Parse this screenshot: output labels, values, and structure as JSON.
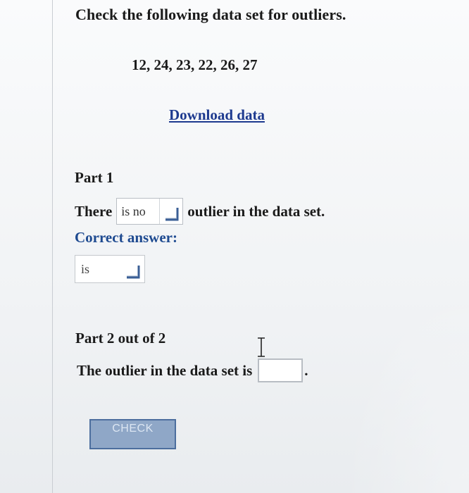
{
  "question": {
    "title": "Check the following data set for outliers.",
    "dataset_text": "12, 24, 23, 22, 26, 27",
    "download_link": "Download data"
  },
  "part1": {
    "heading": "Part 1",
    "sentence_before": "There",
    "selected_value": "is no",
    "sentence_after": "outlier in the data set.",
    "correct_label": "Correct answer:",
    "correct_value": "is"
  },
  "part2": {
    "heading": "Part 2 out of 2",
    "sentence": "The outlier in the data set is",
    "answer_value": "",
    "period": "."
  },
  "buttons": {
    "check_label": "CHECK"
  },
  "colors": {
    "link": "#1d3a8f",
    "correct_label": "#1e4a90",
    "check_button_bg": "#8fa7c7",
    "check_button_border": "#4c6e9e"
  }
}
